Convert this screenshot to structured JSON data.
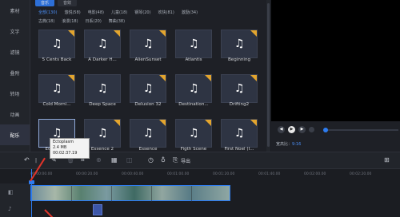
{
  "sidebar": {
    "items": [
      {
        "label": "素材",
        "active": false
      },
      {
        "label": "文字",
        "active": false
      },
      {
        "label": "滤镜",
        "active": false
      },
      {
        "label": "叠附",
        "active": false
      },
      {
        "label": "转场",
        "active": false
      },
      {
        "label": "动画",
        "active": false
      },
      {
        "label": "配乐",
        "active": true
      }
    ]
  },
  "library": {
    "tabs": [
      "音乐",
      "音效"
    ],
    "categories_row1": [
      "全部(130)",
      "悠悦(58)",
      "电影(48)",
      "儿童(18)",
      "钢琴(20)",
      "欢快(81)",
      "激励(34)"
    ],
    "categories_row2": [
      "古典(18)",
      "浪漫(18)",
      "日系(20)",
      "舞曲(38)"
    ],
    "tracks": [
      {
        "title": "5 Cents Back",
        "premium": true
      },
      {
        "title": "A Darker H...",
        "premium": true
      },
      {
        "title": "AlienSunset",
        "premium": true
      },
      {
        "title": "Atlantis",
        "premium": false
      },
      {
        "title": "Beginning",
        "premium": true
      },
      {
        "title": "Cold Morni...",
        "premium": true
      },
      {
        "title": "Deep Space",
        "premium": false
      },
      {
        "title": "Delusion 32",
        "premium": true
      },
      {
        "title": "Destination...",
        "premium": true
      },
      {
        "title": "Drifting2",
        "premium": true
      },
      {
        "title": "Ectoplasm",
        "premium": false,
        "selected": true
      },
      {
        "title": "Essence 2",
        "premium": true
      },
      {
        "title": "Essence",
        "premium": true
      },
      {
        "title": "Figth Scene",
        "premium": true
      },
      {
        "title": "First Noel (I...",
        "premium": true
      }
    ],
    "icon": "music-note-icon"
  },
  "tooltip": {
    "title": "Ectoplasm",
    "size": "2.4 MB",
    "duration": "00:02:37.19"
  },
  "preview": {
    "ratio_label": "宽高比：",
    "ratio_value": "9:16",
    "progress_fraction": 0.02
  },
  "toolbar": {
    "export_label": "导出"
  },
  "timeline": {
    "ticks": [
      "00:00:00.00",
      "00:00:20.00",
      "00:00:40.00",
      "00:01:00.00",
      "00:01:20.00",
      "00:01:40.00",
      "00:02:00.00",
      "00:02:20.00"
    ]
  },
  "colors": {
    "accent": "#2d7cf0",
    "premium_badge": "#e3a52e",
    "annotation_arrow": "#e2342a"
  }
}
